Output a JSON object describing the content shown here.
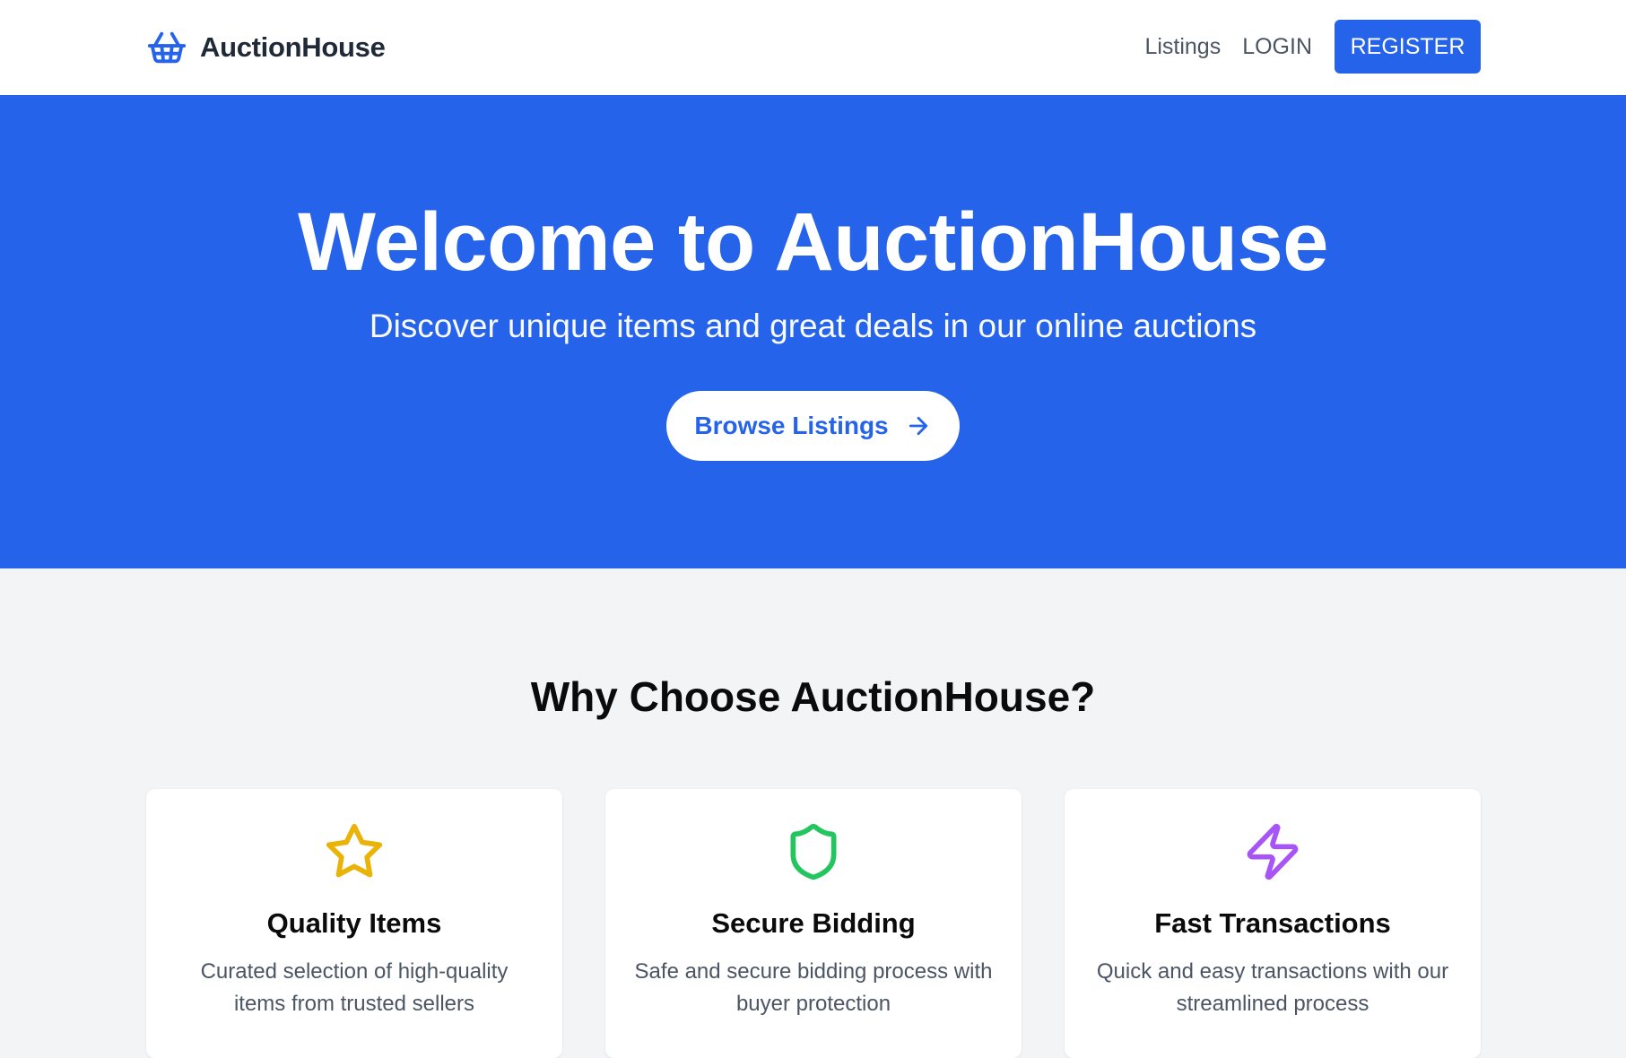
{
  "header": {
    "brand_name": "AuctionHouse",
    "brand_icon": "basket-icon",
    "nav": {
      "listings_label": "Listings",
      "login_label": "LOGIN",
      "register_label": "REGISTER"
    }
  },
  "hero": {
    "title": "Welcome to AuctionHouse",
    "subtitle": "Discover unique items and great deals in our online auctions",
    "cta_label": "Browse Listings",
    "cta_icon": "arrow-right-icon"
  },
  "features": {
    "title": "Why Choose AuctionHouse?",
    "items": [
      {
        "icon": "star-icon",
        "icon_color": "#eab308",
        "title": "Quality Items",
        "description": "Curated selection of high-quality items from trusted sellers"
      },
      {
        "icon": "shield-icon",
        "icon_color": "#22c55e",
        "title": "Secure Bidding",
        "description": "Safe and secure bidding process with buyer protection"
      },
      {
        "icon": "lightning-icon",
        "icon_color": "#a855f7",
        "title": "Fast Transactions",
        "description": "Quick and easy transactions with our streamlined process"
      }
    ]
  },
  "colors": {
    "primary": "#2563eb",
    "page_background": "#f3f4f6",
    "card_background": "#ffffff",
    "muted_text": "#4b5563"
  }
}
